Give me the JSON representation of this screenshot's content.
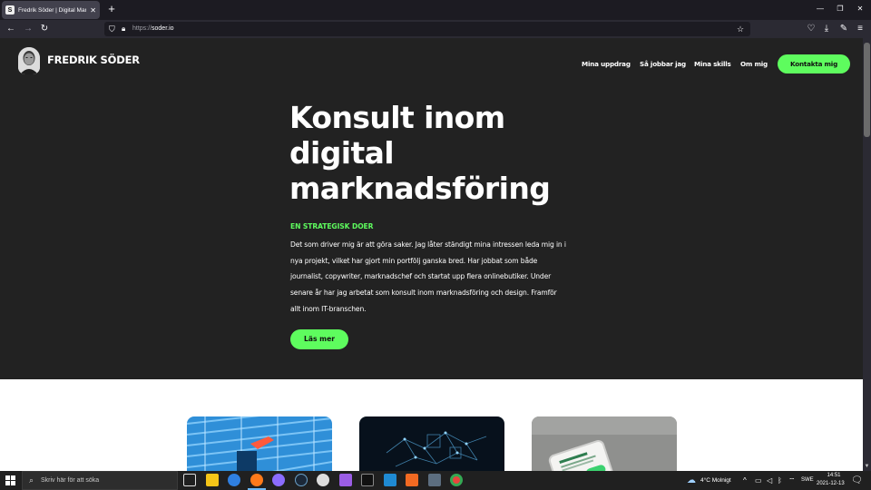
{
  "browser": {
    "tab_title": "Fredrik Söder | Digital Marknadsföring",
    "tab_favicon": "S",
    "url_protocol": "https://",
    "url_host": "soder.io"
  },
  "site": {
    "logo_text": "FREDRIK SÖDER",
    "nav": [
      {
        "label": "Mina uppdrag"
      },
      {
        "label": "Så jobbar jag"
      },
      {
        "label": "Mina skills"
      },
      {
        "label": "Om mig"
      }
    ],
    "cta_label": "Kontakta mig",
    "hero": {
      "title": "Konsult inom digital marknadsföring",
      "kicker": "EN STRATEGISK DOER",
      "body": "Det som driver mig är att göra saker. Jag låter ständigt mina intressen leda mig in i nya projekt, vilket har gjort min portfölj ganska bred. Har jobbat som både journalist, copywriter, marknadschef och startat upp flera onlinebutiker. Under senare år har jag arbetat som konsult inom marknadsföring och design. Framför allt inom IT-branschen.",
      "button_label": "Läs mer"
    },
    "accent_color": "#5efc5e",
    "background_color": "#222222"
  },
  "taskbar": {
    "search_placeholder": "Skriv här för att söka",
    "weather": "4°C  Molnigt",
    "language": "SWE",
    "time": "14:51",
    "date": "2021-12-13"
  }
}
